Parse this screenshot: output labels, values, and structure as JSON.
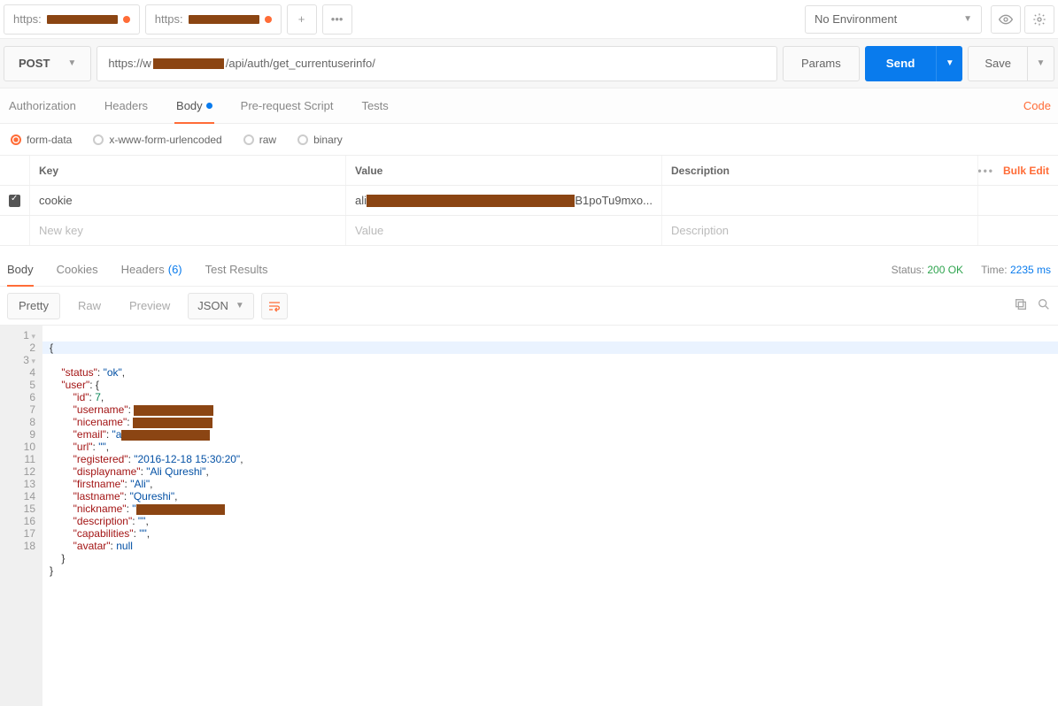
{
  "topTabs": {
    "tab1_prefix": "https:",
    "tab2_prefix": "https:",
    "env_label": "No Environment"
  },
  "request": {
    "method": "POST",
    "url_prefix": "https://w",
    "url_suffix": "/api/auth/get_currentuserinfo/",
    "params": "Params",
    "send": "Send",
    "save": "Save"
  },
  "reqTabs": {
    "auth": "Authorization",
    "headers": "Headers",
    "body": "Body",
    "prereq": "Pre-request Script",
    "tests": "Tests",
    "code": "Code"
  },
  "bodyTypes": {
    "form": "form-data",
    "urlenc": "x-www-form-urlencoded",
    "raw": "raw",
    "binary": "binary"
  },
  "formData": {
    "head_key": "Key",
    "head_value": "Value",
    "head_desc": "Description",
    "bulk": "Bulk Edit",
    "row1_key": "cookie",
    "row1_val_prefix": "ali",
    "row1_val_suffix": "B1poTu9mxo...",
    "new_key": "New key",
    "new_value": "Value",
    "new_desc": "Description"
  },
  "respTabs": {
    "body": "Body",
    "cookies": "Cookies",
    "headers": "Headers",
    "headers_count": "(6)",
    "tests": "Test Results"
  },
  "status": {
    "label": "Status:",
    "value": "200 OK",
    "time_label": "Time:",
    "time_value": "2235 ms"
  },
  "viewBar": {
    "pretty": "Pretty",
    "raw": "Raw",
    "preview": "Preview",
    "lang": "JSON"
  },
  "json": {
    "status_k": "\"status\"",
    "status_v": "\"ok\"",
    "user_k": "\"user\"",
    "id_k": "\"id\"",
    "id_v": "7",
    "username_k": "\"username\"",
    "nicename_k": "\"nicename\"",
    "email_k": "\"email\"",
    "email_v_prefix": "\"a",
    "url_k": "\"url\"",
    "empty_s": "\"\"",
    "registered_k": "\"registered\"",
    "registered_v": "\"2016-12-18 15:30:20\"",
    "displayname_k": "\"displayname\"",
    "displayname_v": "\"Ali Qureshi\"",
    "firstname_k": "\"firstname\"",
    "firstname_v": "\"Ali\"",
    "lastname_k": "\"lastname\"",
    "lastname_v": "\"Qureshi\"",
    "nickname_k": "\"nickname\"",
    "nickname_v_prefix": "\"",
    "description_k": "\"description\"",
    "capabilities_k": "\"capabilities\"",
    "avatar_k": "\"avatar\"",
    "null_v": "null"
  }
}
